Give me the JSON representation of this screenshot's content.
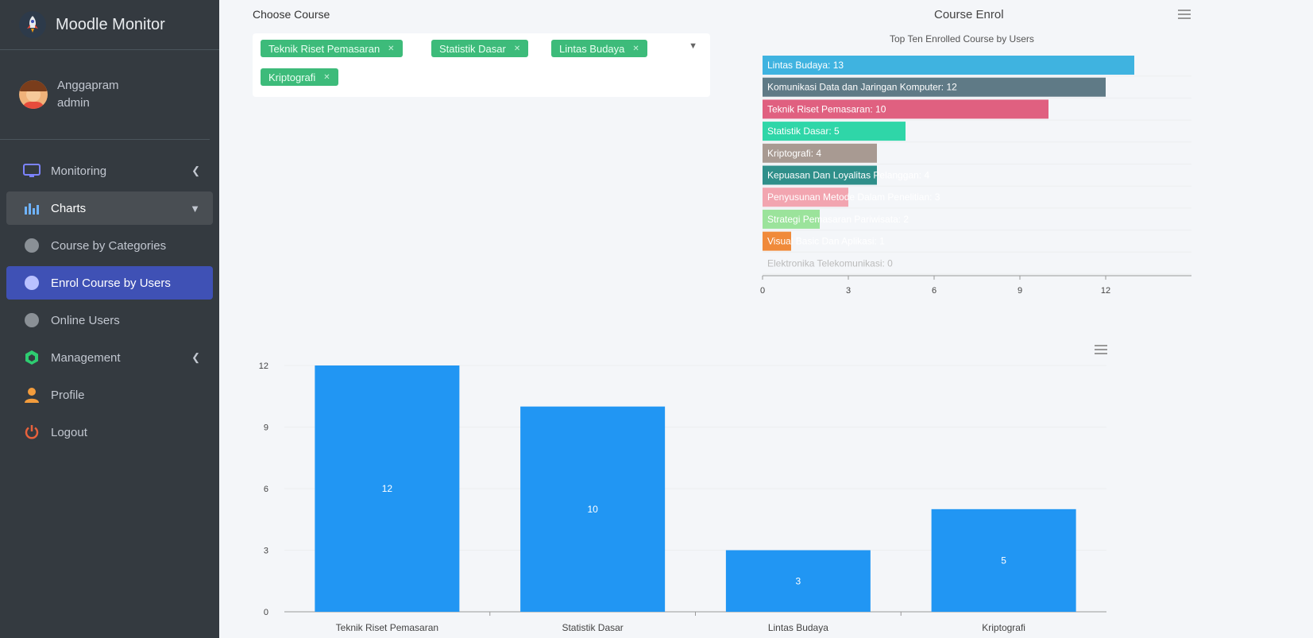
{
  "app": {
    "title": "Moodle Monitor"
  },
  "user": {
    "name": "Anggapram",
    "role": "admin"
  },
  "nav": {
    "monitoring": "Monitoring",
    "charts": "Charts",
    "course_by_categories": "Course by Categories",
    "enrol_course_by_users": "Enrol Course by Users",
    "online_users": "Online Users",
    "management": "Management",
    "profile": "Profile",
    "logout": "Logout"
  },
  "course_select": {
    "label": "Choose Course",
    "selected": [
      "Teknik Riset Pemasaran",
      "Statistik Dasar",
      "Lintas Budaya",
      "Kriptografi"
    ]
  },
  "colors": {
    "sidebar": "#343a40",
    "active_nav": "#3f51b5",
    "chip": "#3dbb7a",
    "bar": "#2196f3"
  },
  "chart_data": [
    {
      "type": "bar",
      "orientation": "horizontal",
      "title": "Course Enrol",
      "subtitle": "Top Ten Enrolled Course by Users",
      "categories": [
        "Lintas Budaya",
        "Komunikasi Data dan Jaringan Komputer",
        "Teknik Riset Pemasaran",
        "Statistik Dasar",
        "Kriptografi",
        "Kepuasan Dan Loyalitas Pelanggan",
        "Penyusunan Metode Dalam Penelitian",
        "Strategi Pemasaran Pariwisata",
        "Visual Basic Dan Aplikasi",
        "Elektronika Telekomunikasi"
      ],
      "values": [
        13,
        12,
        10,
        5,
        4,
        4,
        3,
        2,
        1,
        0
      ],
      "colors": [
        "#3fb3e0",
        "#5f7a86",
        "#e06080",
        "#2fd6a8",
        "#a89a92",
        "#2f8f8a",
        "#f2a5b0",
        "#9be39b",
        "#f08a3a",
        "#ffffff"
      ],
      "xticks": [
        0,
        3,
        6,
        9,
        12
      ],
      "xlim": [
        0,
        15
      ],
      "grid": true
    },
    {
      "type": "bar",
      "categories": [
        "Teknik Riset Pemasaran",
        "Statistik Dasar",
        "Lintas Budaya",
        "Kriptografi"
      ],
      "values": [
        12,
        10,
        3,
        5
      ],
      "yticks": [
        0,
        3,
        6,
        9,
        12
      ],
      "ylim": [
        0,
        12
      ],
      "grid": true
    }
  ]
}
